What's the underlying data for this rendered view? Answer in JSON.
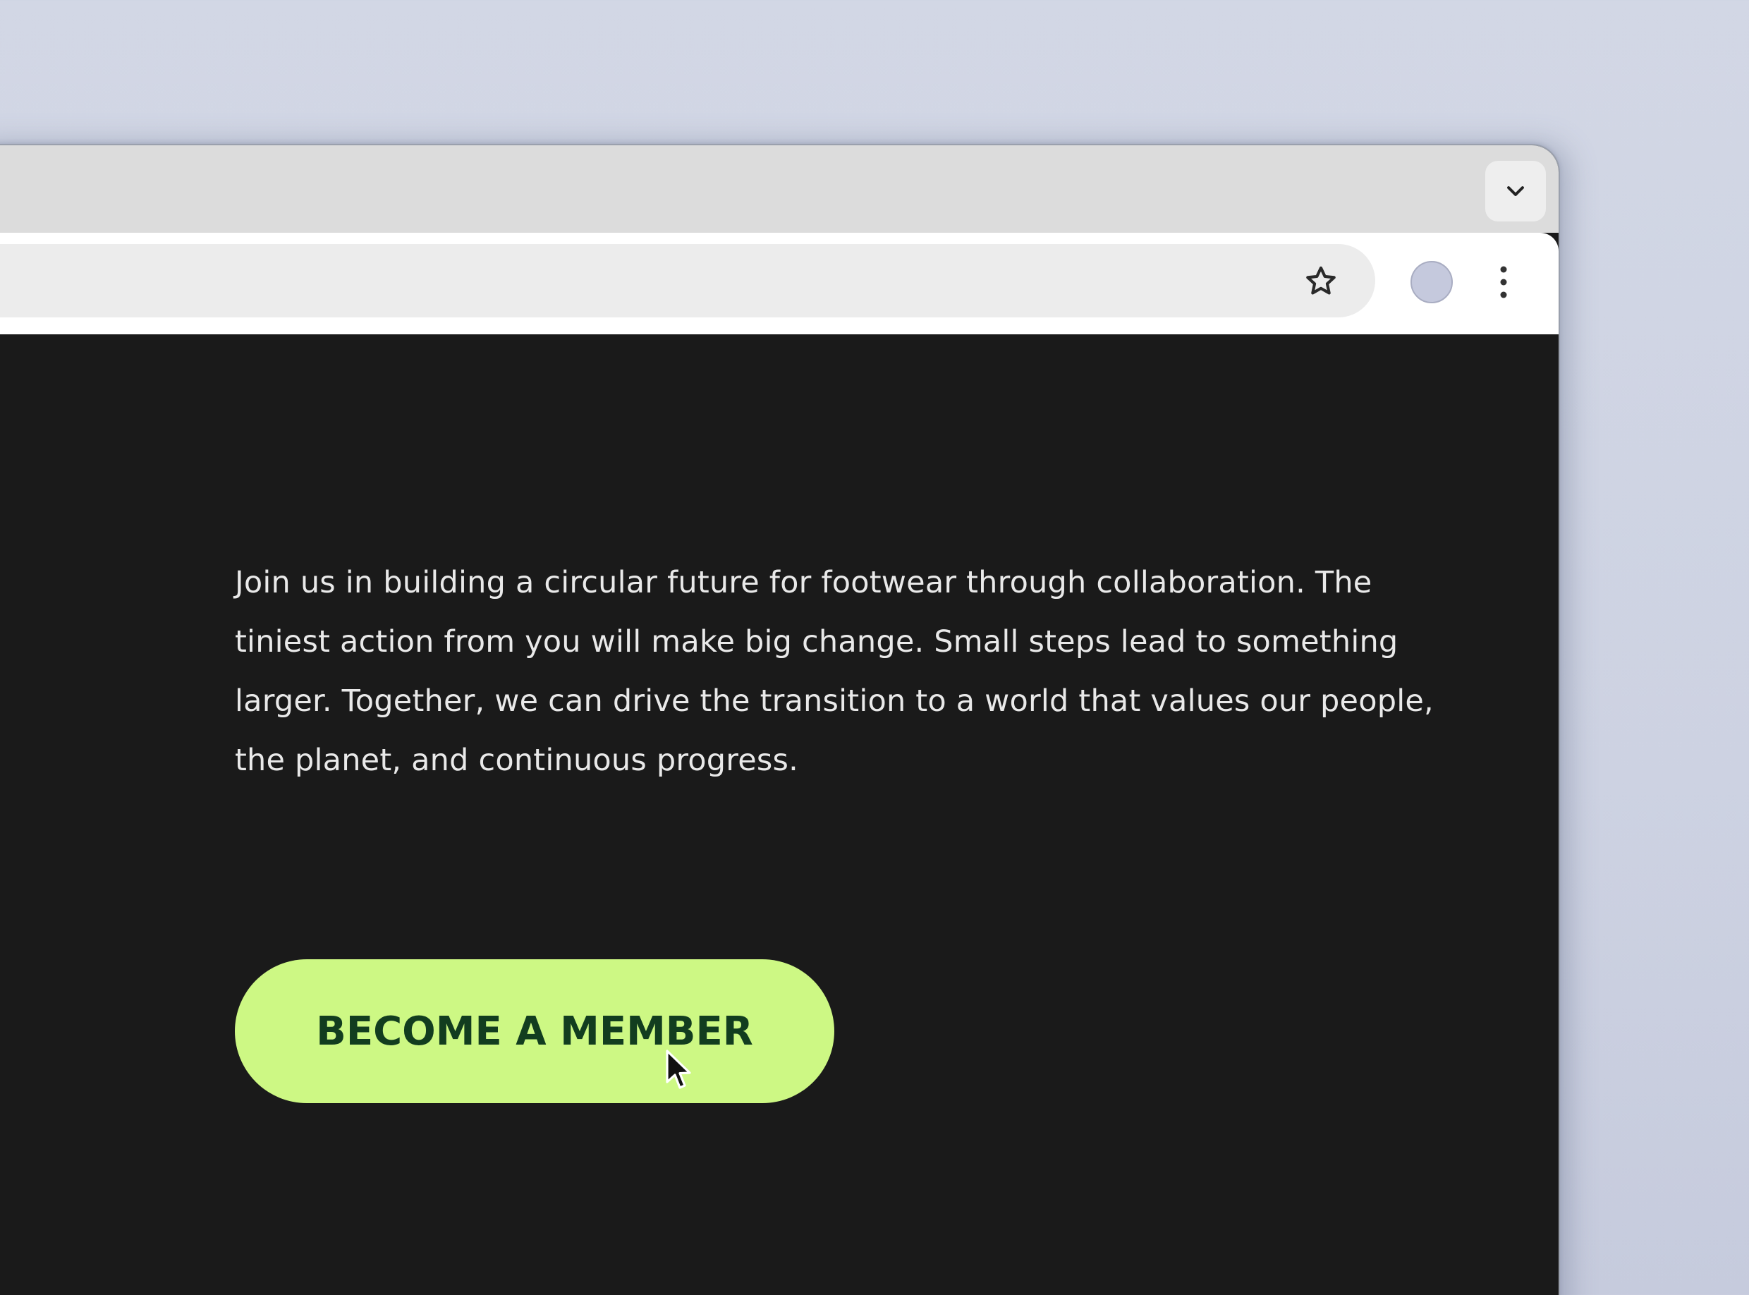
{
  "browser": {
    "tab_strip": {
      "dropdown_icon": "chevron-down-icon"
    },
    "toolbar": {
      "bookmark_icon": "star-outline-icon",
      "profile_icon": "avatar-circle",
      "menu_icon": "vertical-ellipsis-icon"
    }
  },
  "page": {
    "intro_text": "Join us in building a circular future for footwear through collaboration. The tiniest action from you will make big change. Small steps lead to something larger. Together, we can drive the transition to a world that values our people, the planet, and continuous progress.",
    "cta_label": "BECOME A MEMBER"
  },
  "colors": {
    "page_background": "#1a1a1a",
    "text": "#e9e9e9",
    "cta_background": "#cdf884",
    "cta_text": "#123d1f"
  }
}
